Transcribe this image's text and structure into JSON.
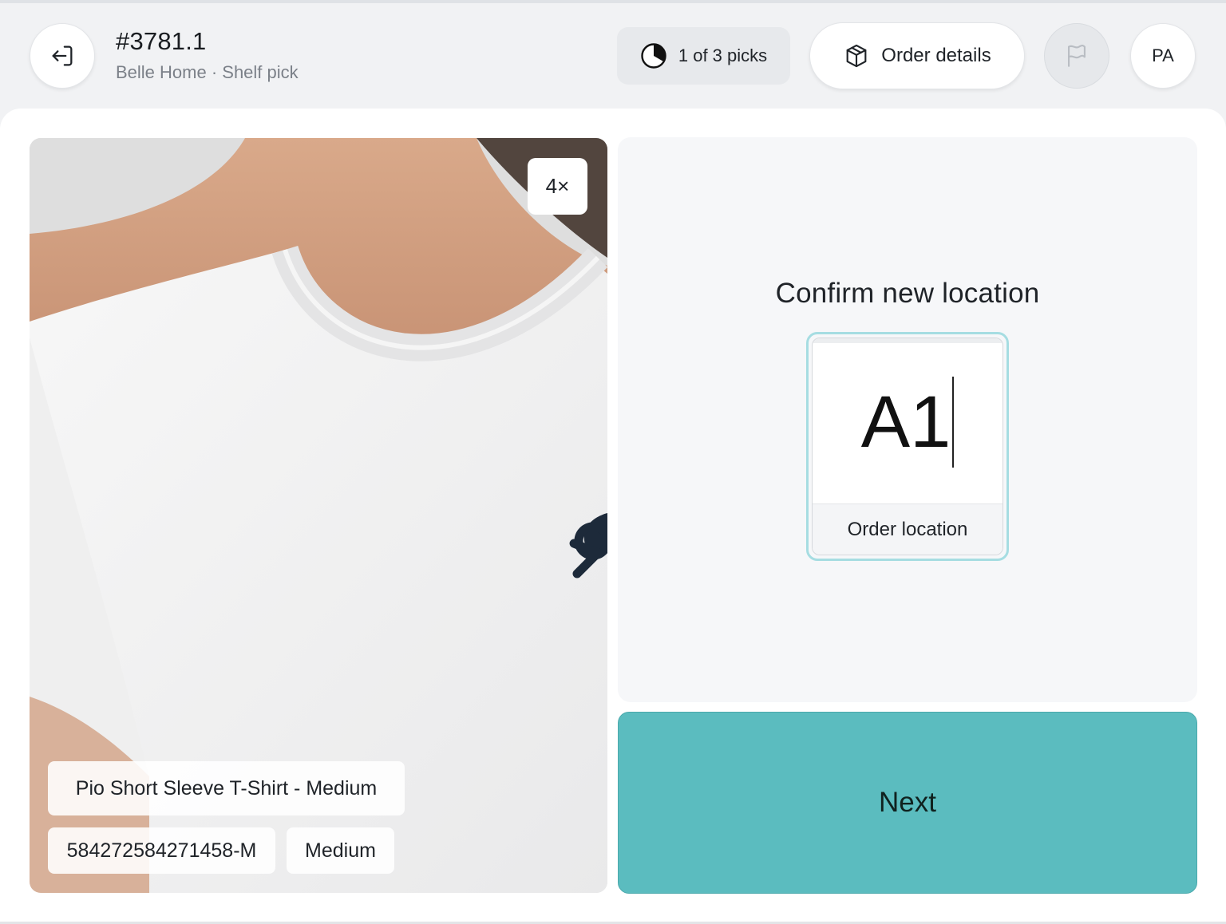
{
  "header": {
    "order_id": "#3781.1",
    "subtitle": "Belle Home · Shelf pick",
    "picks_label": "1 of 3 picks",
    "picks_progress": 0.333,
    "order_details_label": "Order details",
    "avatar_initials": "PA"
  },
  "product": {
    "quantity": "4×",
    "name": "Pio Short Sleeve T-Shirt - Medium",
    "sku": "584272584271458-M",
    "size": "Medium",
    "image_icon": "product-photo"
  },
  "confirm": {
    "title": "Confirm new location",
    "location_value": "A1",
    "location_label": "Order location"
  },
  "actions": {
    "next_label": "Next"
  },
  "colors": {
    "accent": "#5bbcbf",
    "focus_ring": "#a6dde2",
    "background": "#f1f2f4"
  }
}
